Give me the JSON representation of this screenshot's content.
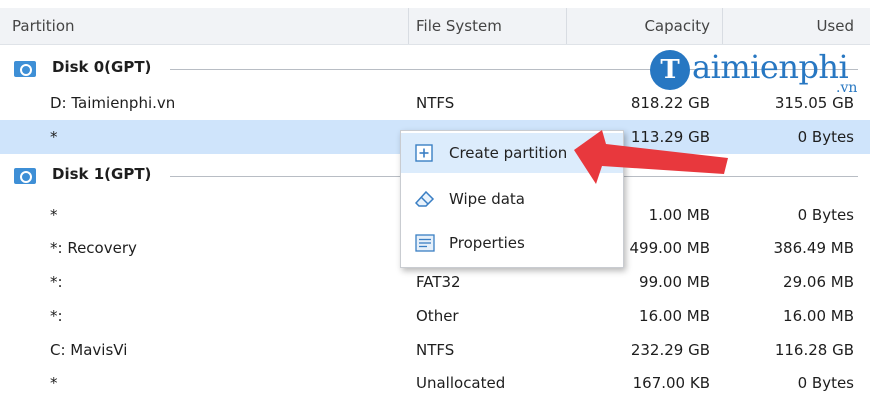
{
  "header": {
    "partition": "Partition",
    "file_system": "File System",
    "capacity": "Capacity",
    "used": "Used"
  },
  "disk0": {
    "label": "Disk 0(GPT)",
    "rows": [
      {
        "name": "D: Taimienphi.vn",
        "fs": "NTFS",
        "capacity": "818.22 GB",
        "used": "315.05 GB"
      },
      {
        "name": "*",
        "fs": "",
        "capacity": "113.29 GB",
        "used": "0 Bytes"
      }
    ]
  },
  "disk1": {
    "label": "Disk 1(GPT)",
    "rows": [
      {
        "name": "*",
        "fs": "",
        "capacity": "1.00 MB",
        "used": "0 Bytes"
      },
      {
        "name": "*: Recovery",
        "fs": "",
        "capacity": "499.00 MB",
        "used": "386.49 MB"
      },
      {
        "name": "*:",
        "fs": "FAT32",
        "capacity": "99.00 MB",
        "used": "29.06 MB"
      },
      {
        "name": "*:",
        "fs": "Other",
        "capacity": "16.00 MB",
        "used": "16.00 MB"
      },
      {
        "name": "C: MavisVi",
        "fs": "NTFS",
        "capacity": "232.29 GB",
        "used": "116.28 GB"
      },
      {
        "name": "*",
        "fs": "Unallocated",
        "capacity": "167.00 KB",
        "used": "0 Bytes"
      }
    ]
  },
  "context_menu": {
    "create_partition": "Create partition",
    "wipe_data": "Wipe data",
    "properties": "Properties"
  },
  "watermark": {
    "letter": "T",
    "text": "aimienphi",
    "sub": ".vn"
  },
  "colors": {
    "selection": "#cfe4fb",
    "accent": "#2777c2",
    "arrow": "#e8383d"
  },
  "icons": {
    "disk": "disk-icon",
    "create": "plus-square-icon",
    "wipe": "eraser-icon",
    "properties": "properties-icon"
  }
}
